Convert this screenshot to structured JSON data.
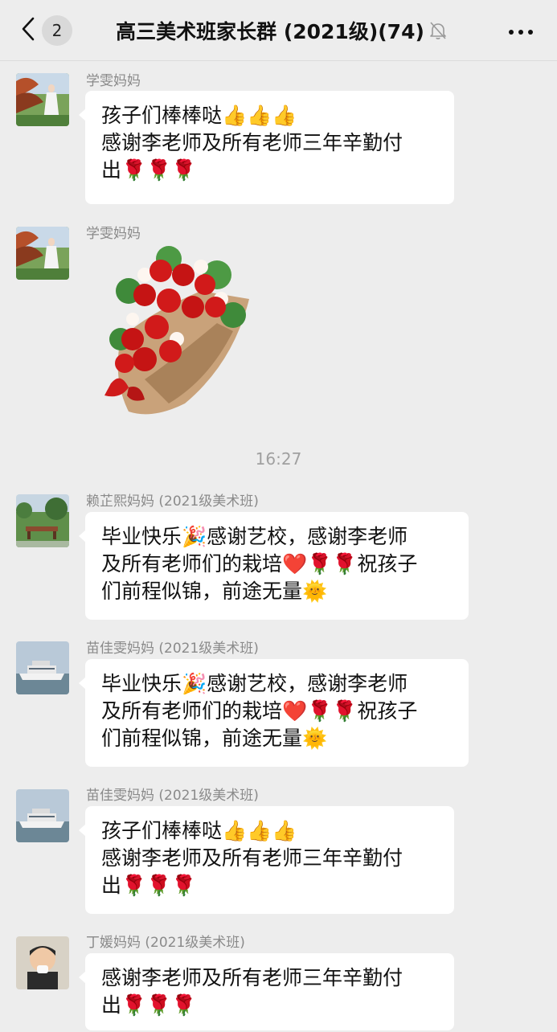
{
  "header": {
    "back_icon": "chevron-left-icon",
    "unread_count": "2",
    "title": "高三美术班家长群 (2021级)(74)",
    "mute_icon": "bell-off-icon",
    "more_icon": "more-dots-icon"
  },
  "messages": [
    {
      "sender": "学雯妈妈",
      "lines": [
        "孩子们棒棒哒👍👍👍",
        "感谢李老师及所有老师三年辛勤付",
        "出🌹🌹🌹"
      ]
    },
    {
      "sender": "学雯妈妈",
      "sticker": "rose-bouquet-sticker"
    },
    {
      "timestamp": "16:27"
    },
    {
      "sender": "赖芷熙妈妈 (2021级美术班)",
      "lines": [
        "毕业快乐🎉感谢艺校，感谢李老师",
        "及所有老师们的栽培❤️🌹🌹祝孩子",
        "们前程似锦，前途无量🌞"
      ]
    },
    {
      "sender": "苗佳雯妈妈 (2021级美术班)",
      "lines": [
        "毕业快乐🎉感谢艺校，感谢李老师",
        "及所有老师们的栽培❤️🌹🌹祝孩子",
        "们前程似锦，前途无量🌞"
      ]
    },
    {
      "sender": "苗佳雯妈妈 (2021级美术班)",
      "lines": [
        "孩子们棒棒哒👍👍👍",
        "感谢李老师及所有老师三年辛勤付",
        "出🌹🌹🌹"
      ]
    },
    {
      "sender": "丁媛妈妈 (2021级美术班)",
      "lines": [
        "感谢李老师及所有老师三年辛勤付",
        "出🌹🌹🌹"
      ]
    }
  ],
  "colors": {
    "background": "#ededed",
    "bubble": "#ffffff",
    "sender_text": "#8a8a8a",
    "timestamp_text": "#a0a0a0"
  }
}
